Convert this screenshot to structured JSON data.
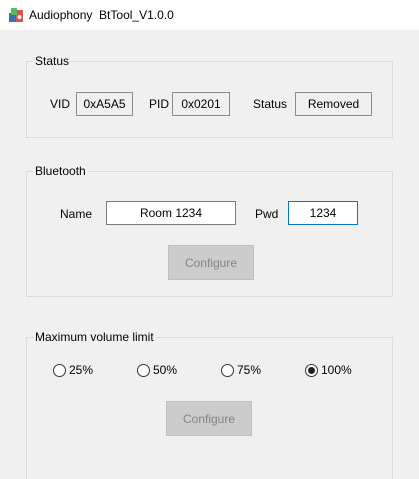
{
  "window": {
    "title": "Audiophony  BtTool_V1.0.0"
  },
  "status_group": {
    "title": "Status",
    "vid_label": "VID",
    "vid_value": "0xA5A5",
    "pid_label": "PID",
    "pid_value": "0x0201",
    "status_label": "Status",
    "status_value": "Removed"
  },
  "bluetooth_group": {
    "title": "Bluetooth",
    "name_label": "Name",
    "name_value": "Room 1234",
    "pwd_label": "Pwd",
    "pwd_value": "1234",
    "configure_label": "Configure"
  },
  "volume_group": {
    "title": "Maximum volume limit",
    "options": [
      {
        "label": "25%",
        "checked": false
      },
      {
        "label": "50%",
        "checked": false
      },
      {
        "label": "75%",
        "checked": false
      },
      {
        "label": "100%",
        "checked": true
      }
    ],
    "configure_label": "Configure"
  },
  "colors": {
    "background": "#f0f0f0",
    "titlebar": "#ffffff",
    "focus_border": "#0078d7",
    "disabled_button": "#cccccc",
    "disabled_text": "#838383"
  },
  "icons": {
    "app": "speaker-app-icon"
  }
}
